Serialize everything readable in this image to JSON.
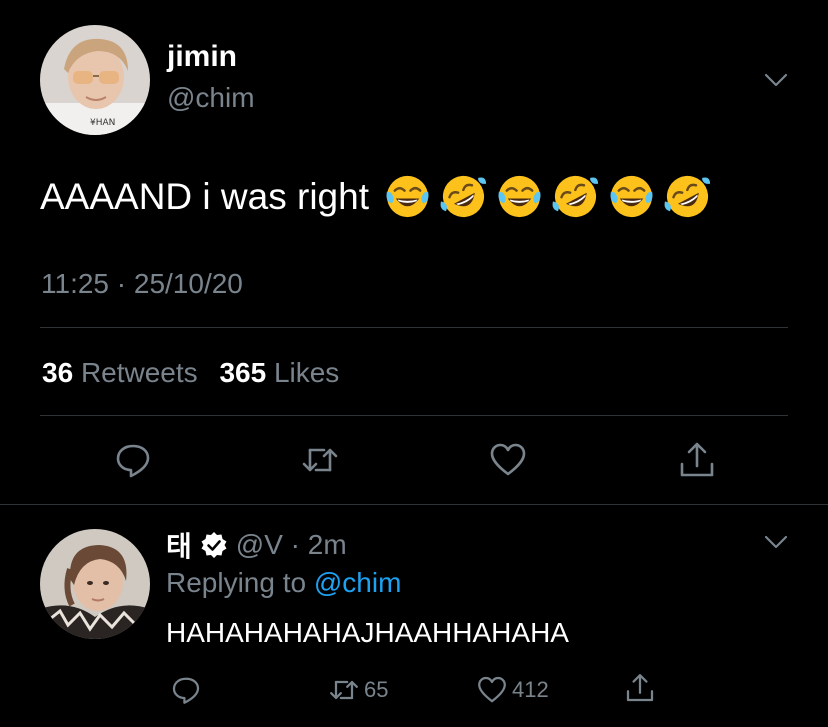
{
  "colors": {
    "background": "#000000",
    "text_primary": "#ffffff",
    "text_secondary": "#7a848d",
    "divider": "#2f3336",
    "accent": "#1da1f2"
  },
  "tweet": {
    "author_name": "jimin",
    "author_handle": "@chim",
    "text": "AAAAND i was right",
    "emojis": [
      "face-with-tears-of-joy",
      "rolling-on-the-floor-laughing",
      "face-with-tears-of-joy",
      "rolling-on-the-floor-laughing",
      "face-with-tears-of-joy",
      "rolling-on-the-floor-laughing"
    ],
    "timestamp": "11:25 · 25/10/20",
    "retweet_count": "36",
    "retweet_label": "Retweets",
    "like_count": "365",
    "like_label": "Likes",
    "actions": [
      "reply-icon",
      "retweet-icon",
      "like-icon",
      "share-icon"
    ]
  },
  "reply": {
    "author_name": "태",
    "verified": true,
    "handle_time": "@V · 2m",
    "replying_prefix": "Replying to",
    "replying_mention": "@chim",
    "text": "HAHAHAHAHAJHAAHHAHAHA",
    "retweet_count": "65",
    "like_count": "412",
    "actions": [
      "reply-icon",
      "retweet-icon",
      "like-icon",
      "share-icon"
    ]
  }
}
